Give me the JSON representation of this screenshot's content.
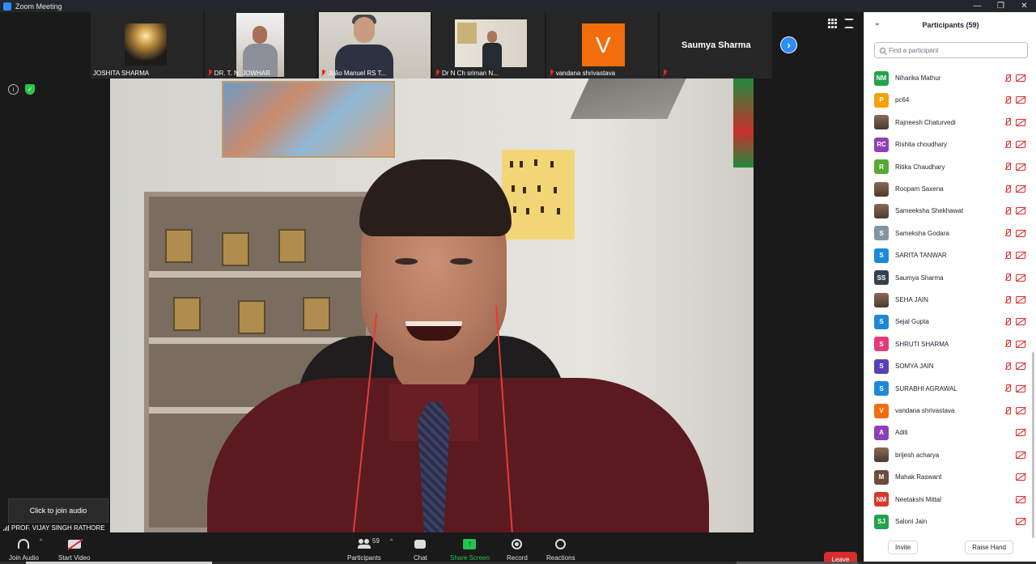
{
  "window": {
    "title": "Zoom Meeting",
    "minimize": "—",
    "maximize": "❐",
    "close": "✕"
  },
  "gallery": [
    {
      "name": "JOSHITA SHARMA",
      "muted": false
    },
    {
      "name": "DR. T. N. JOWHAR",
      "muted": true
    },
    {
      "name": "João Manuel RS T...",
      "muted": true
    },
    {
      "name": "Dr N Ch sriman N...",
      "muted": true
    },
    {
      "name": "vandana shrivastava",
      "muted": true,
      "avatar_letter": "V",
      "avatar_color": "#f26d0b"
    },
    {
      "name": "Saumya Sharma",
      "muted": true
    }
  ],
  "next_page_arrow": "›",
  "info_icon_glyph": "i",
  "shield_glyph": "✓",
  "join_audio_tooltip": "Click to join audio",
  "active_speaker": "PROF. VIJAY SINGH RATHORE",
  "toolbar": {
    "join_audio": "Join Audio",
    "start_video": "Start Video",
    "participants": "Participants",
    "participants_count": "59",
    "chat": "Chat",
    "share_screen": "Share Screen",
    "share_arrow": "↑",
    "record": "Record",
    "reactions": "Reactions",
    "leave": "Leave",
    "caret": "^"
  },
  "panel": {
    "title": "Participants (59)",
    "collapse_glyph": "⌄",
    "search_placeholder": "Find a participant",
    "invite": "Invite",
    "raise_hand": "Raise Hand",
    "participants": [
      {
        "name": "Niharika Mathur",
        "initials": "NM",
        "color": "#23a24d",
        "mic_muted": true
      },
      {
        "name": "pc64",
        "initials": "P",
        "color": "#f4a10b",
        "mic_muted": true
      },
      {
        "name": "Rajneesh Chaturvedi",
        "initials": "",
        "color": "#7a5a46",
        "photo": true,
        "mic_muted": true
      },
      {
        "name": "Rishita choudhary",
        "initials": "RC",
        "color": "#8e3fb5",
        "mic_muted": true
      },
      {
        "name": "Ritika Chaudhary",
        "initials": "R",
        "color": "#59a836",
        "mic_muted": true
      },
      {
        "name": "Roopam Saxena",
        "initials": "",
        "color": "#c4894f",
        "photo": true,
        "mic_muted": true
      },
      {
        "name": "Sameeksha Shekhawat",
        "initials": "",
        "color": "#8a7050",
        "photo": true,
        "mic_muted": true
      },
      {
        "name": "Sameksha Godara",
        "initials": "S",
        "color": "#8394a0",
        "mic_muted": true
      },
      {
        "name": "SARITA TANWAR",
        "initials": "S",
        "color": "#1e88d6",
        "mic_muted": true
      },
      {
        "name": "Saumya Sharma",
        "initials": "SS",
        "color": "#33404d",
        "mic_muted": true
      },
      {
        "name": "SEHA JAIN",
        "initials": "",
        "color": "#6a4a3a",
        "photo": true,
        "mic_muted": true
      },
      {
        "name": "Sejal Gupta",
        "initials": "S",
        "color": "#1e88d6",
        "mic_muted": true
      },
      {
        "name": "SHRUTI SHARMA",
        "initials": "S",
        "color": "#e03b7a",
        "mic_muted": true
      },
      {
        "name": "SOMYA JAIN",
        "initials": "S",
        "color": "#5b3fb5",
        "mic_muted": true
      },
      {
        "name": "SURABHI AGRAWAL",
        "initials": "S",
        "color": "#1e88d6",
        "mic_muted": true
      },
      {
        "name": "vandana shrivastava",
        "initials": "V",
        "color": "#f26d0b",
        "mic_muted": true
      },
      {
        "name": "Aditi",
        "initials": "A",
        "color": "#8e3fb5",
        "mic_muted": false
      },
      {
        "name": "brijesh acharya",
        "initials": "",
        "color": "#9a8670",
        "photo": true,
        "mic_muted": false
      },
      {
        "name": "Mahak Raswant",
        "initials": "M",
        "color": "#6d4c3d",
        "mic_muted": false
      },
      {
        "name": "Neetakshi Mittal",
        "initials": "NM",
        "color": "#d8392c",
        "mic_muted": false
      },
      {
        "name": "Saloni Jain",
        "initials": "SJ",
        "color": "#23a24d",
        "mic_muted": false
      }
    ]
  }
}
